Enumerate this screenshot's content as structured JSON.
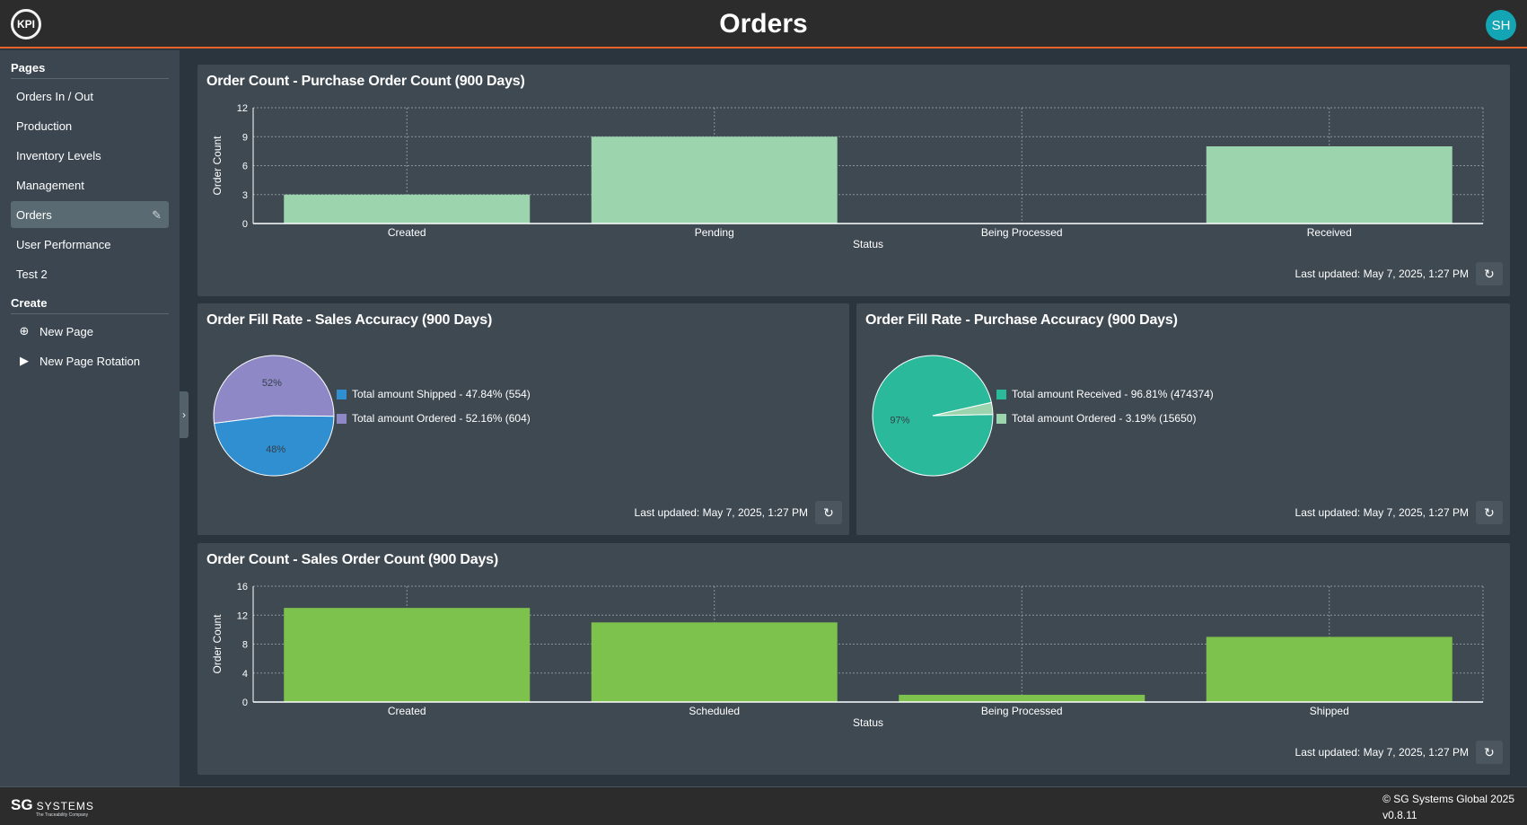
{
  "header": {
    "title": "Orders",
    "logo_text": "KPI",
    "avatar_initials": "SH"
  },
  "sidebar": {
    "pages_heading": "Pages",
    "pages": [
      {
        "label": "Orders In / Out"
      },
      {
        "label": "Production"
      },
      {
        "label": "Inventory Levels"
      },
      {
        "label": "Management"
      },
      {
        "label": "Orders",
        "active": true
      },
      {
        "label": "User Performance"
      },
      {
        "label": "Test 2"
      }
    ],
    "create_heading": "Create",
    "create_items": [
      {
        "label": "New Page",
        "icon": "plus-circle-icon"
      },
      {
        "label": "New Page Rotation",
        "icon": "play-icon"
      }
    ]
  },
  "cards": {
    "purchase_count": {
      "title": "Order Count - Purchase Order Count (900 Days)",
      "updated": "Last updated: May 7, 2025, 1:27 PM"
    },
    "sales_accuracy": {
      "title": "Order Fill Rate - Sales Accuracy (900 Days)",
      "updated": "Last updated: May 7, 2025, 1:27 PM"
    },
    "purchase_accuracy": {
      "title": "Order Fill Rate - Purchase Accuracy (900 Days)",
      "updated": "Last updated: May 7, 2025, 1:27 PM"
    },
    "sales_count": {
      "title": "Order Count - Sales Order Count (900 Days)",
      "updated": "Last updated: May 7, 2025, 1:27 PM"
    }
  },
  "footer": {
    "brand_sg": "SG",
    "brand_systems": "SYSTEMS",
    "tagline": "The Traceability Company",
    "copyright": "© SG Systems Global 2025",
    "version": "v0.8.11"
  },
  "chart_data": [
    {
      "type": "bar",
      "title": "Order Count - Purchase Order Count (900 Days)",
      "categories": [
        "Created",
        "Pending",
        "Being Processed",
        "Received"
      ],
      "values": [
        3,
        9,
        0,
        8
      ],
      "xlabel": "Status",
      "ylabel": "Order Count",
      "ylim": [
        0,
        12
      ],
      "yticks": [
        "0",
        "3",
        "6",
        "9",
        "12"
      ],
      "color": "#9cd4ae",
      "grid": true
    },
    {
      "type": "pie",
      "title": "Order Fill Rate - Sales Accuracy (900 Days)",
      "slices": [
        {
          "label": "Total amount Shipped - 47.84% (554)",
          "value": 554,
          "pct_label": "48%",
          "color": "#2f8fd1"
        },
        {
          "label": "Total amount Ordered - 52.16% (604)",
          "value": 604,
          "pct_label": "52%",
          "color": "#8e89c6"
        }
      ],
      "legend": "right"
    },
    {
      "type": "pie",
      "title": "Order Fill Rate - Purchase Accuracy (900 Days)",
      "slices": [
        {
          "label": "Total amount Received - 96.81% (474374)",
          "value": 474374,
          "pct_label": "97%",
          "color": "#2bb99c"
        },
        {
          "label": "Total amount Ordered - 3.19% (15650)",
          "value": 15650,
          "pct_label": "",
          "color": "#9cd4ae"
        }
      ],
      "legend": "right"
    },
    {
      "type": "bar",
      "title": "Order Count - Sales Order Count (900 Days)",
      "categories": [
        "Created",
        "Scheduled",
        "Being Processed",
        "Shipped"
      ],
      "values": [
        13,
        11,
        1,
        9
      ],
      "xlabel": "Status",
      "ylabel": "Order Count",
      "ylim": [
        0,
        16
      ],
      "yticks": [
        "0",
        "4",
        "8",
        "12",
        "16"
      ],
      "color": "#7dc24d",
      "grid": true
    }
  ]
}
